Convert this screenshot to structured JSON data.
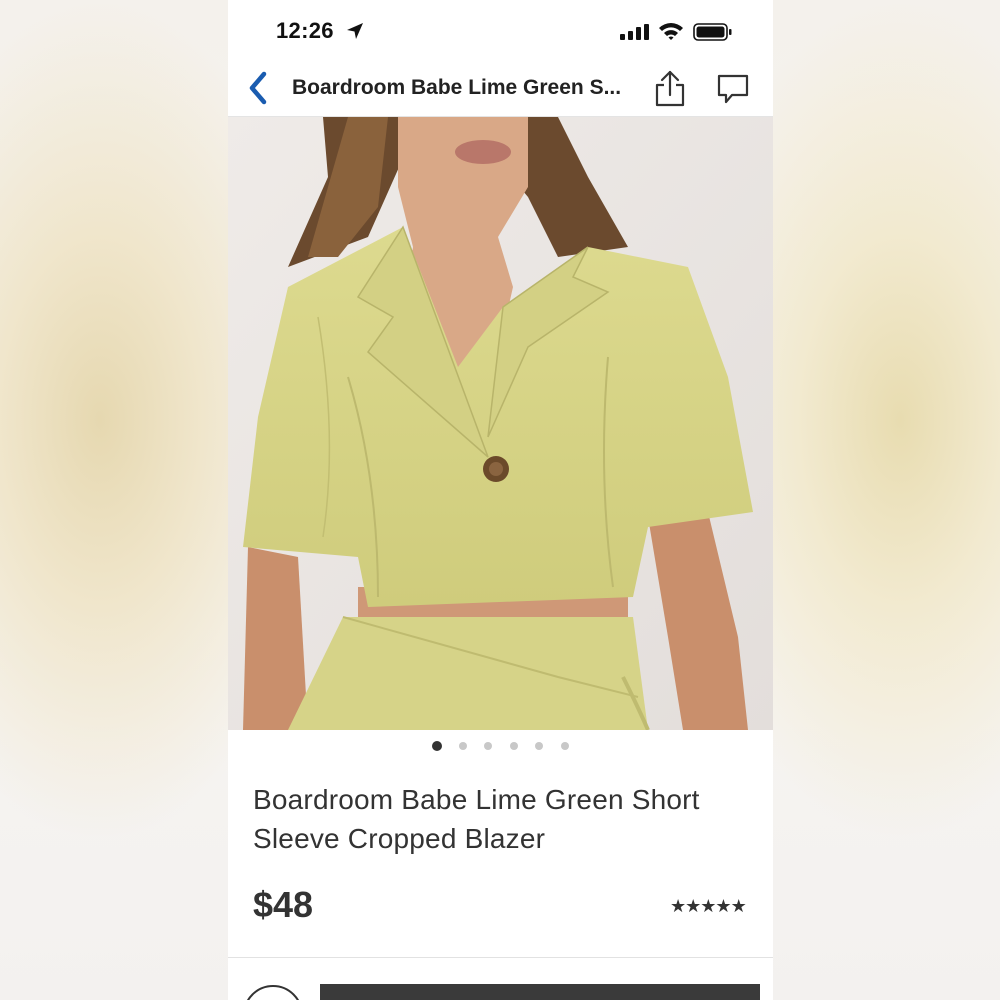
{
  "status_bar": {
    "time": "12:26",
    "icons": [
      "location-arrow-icon",
      "signal-icon",
      "wifi-icon",
      "battery-icon"
    ]
  },
  "nav": {
    "title": "Boardroom Babe Lime Green S...",
    "icons": [
      "back-chevron-icon",
      "share-icon",
      "comment-icon"
    ],
    "accent_color": "#1a5cb0"
  },
  "product": {
    "image_description_colors": {
      "blazer": "#d9d78a",
      "background": "#ebe7e4"
    },
    "carousel": {
      "count": 6,
      "active_index": 0
    },
    "title": "Boardroom Babe Lime Green Short Sleeve Cropped Blazer",
    "price": "$48",
    "rating_stars": 5
  }
}
